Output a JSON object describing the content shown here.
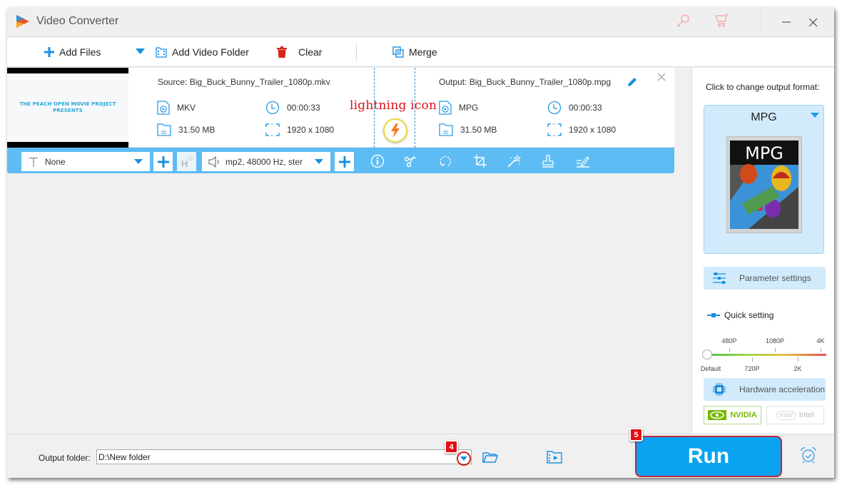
{
  "window": {
    "title": "Video Converter",
    "icons": [
      "app-logo",
      "key-icon",
      "cart-icon",
      "minimize-icon",
      "close-icon"
    ]
  },
  "toolbar": {
    "add_files": "Add Files",
    "add_video_folder": "Add Video Folder",
    "clear": "Clear",
    "merge": "Merge"
  },
  "file_item": {
    "thumbnail_text_line1": "THE PEACH OPEN MOVIE PROJECT",
    "thumbnail_text_line2": "PRESENTS",
    "source": {
      "name": "Source: Big_Buck_Bunny_Trailer_1080p.mkv",
      "format": "MKV",
      "duration": "00:00:33",
      "size": "31.50 MB",
      "resolution": "1920 x 1080"
    },
    "output": {
      "name": "Output: Big_Buck_Bunny_Trailer_1080p.mpg",
      "format": "MPG",
      "duration": "00:00:33",
      "size": "31.50 MB",
      "resolution": "1920 x 1080"
    },
    "annotation": "lightning icon"
  },
  "edit_bar": {
    "subtitle_value": "None",
    "audio_value": "mp2, 48000 Hz, ster",
    "tools": [
      "info-icon",
      "cut-icon",
      "rotate-icon",
      "crop-icon",
      "effect-wand-icon",
      "watermark-stamp-icon",
      "edit-subtitle-icon"
    ]
  },
  "right_panel": {
    "change_format_label": "Click to change output format:",
    "format_name": "MPG",
    "format_image_label": "MPG",
    "parameter_settings": "Parameter settings",
    "quick_setting": "Quick setting",
    "slider": {
      "top_labels": [
        "480P",
        "1080P",
        "4K"
      ],
      "bottom_labels": [
        "Default",
        "720P",
        "2K"
      ],
      "selected": "Default",
      "value_fraction": 0
    },
    "hardware_acceleration": "Hardware acceleration",
    "gpu_nvidia": "NVIDIA",
    "gpu_intel": "Intel",
    "intel_logo_text": "intel"
  },
  "bottom_bar": {
    "output_folder_label": "Output folder:",
    "output_folder_value": "D:\\New folder",
    "badge_4": "4",
    "badge_5": "5",
    "run_label": "Run"
  },
  "colors": {
    "accent_blue": "#0aa3f2",
    "edit_bar_blue": "#5ebcf4",
    "annotation_red": "#e0101c",
    "lightning_orange": "#f47b20"
  }
}
